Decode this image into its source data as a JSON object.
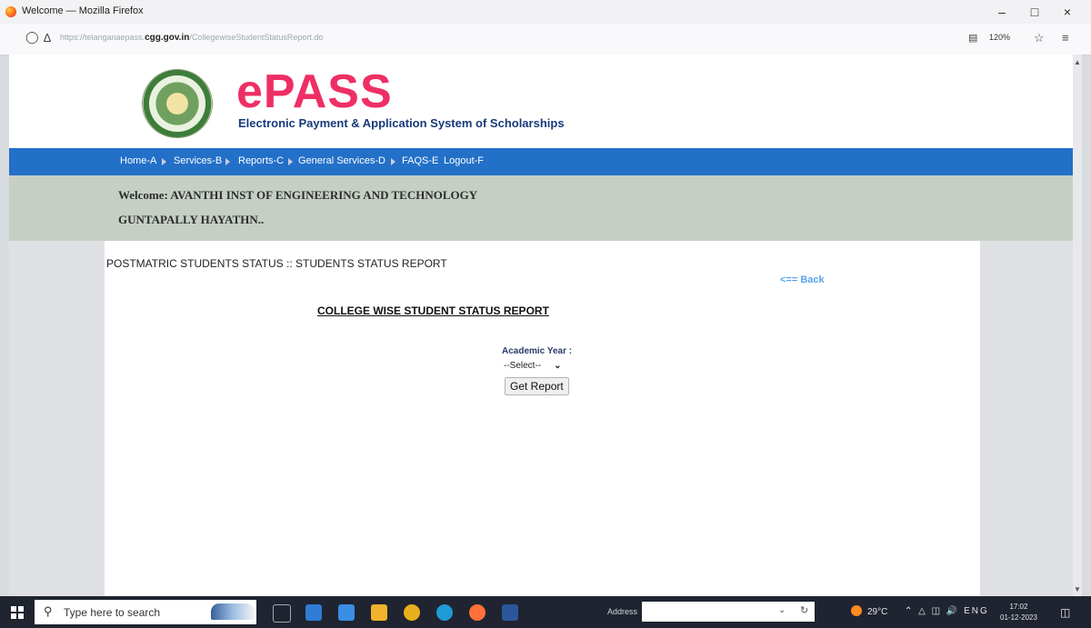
{
  "window": {
    "title": "Welcome — Mozilla Firefox",
    "controls": {
      "minimize": "–",
      "maximize": "□",
      "close": "×"
    }
  },
  "browser": {
    "url_prefix": "https://telanganaepass.",
    "url_domain": "cgg.gov.in",
    "url_path": "/CollegewiseStudentStatusReport.do",
    "zoom": "120%",
    "icons": [
      "circle-icon",
      "lock-icon",
      "reader-icon",
      "star-icon",
      "menu-icon"
    ]
  },
  "site": {
    "logo": "ePASS",
    "subtitle": "Electronic Payment & Application System of Scholarships",
    "nav": [
      "Home-A",
      "Services-B",
      "Reports-C",
      "General Services-D",
      "FAQS-E",
      "Logout-F"
    ],
    "welcome_line1": "Welcome: AVANTHI INST OF ENGINEERING AND TECHNOLOGY",
    "welcome_line2": "GUNTAPALLY HAYATHN.."
  },
  "report": {
    "breadcrumb": "POSTMATRIC STUDENTS STATUS :: STUDENTS STATUS REPORT",
    "back_link": "<== Back",
    "title": "COLLEGE WISE STUDENT STATUS REPORT",
    "academic_year_label": "Academic Year :",
    "academic_year_selected": "--Select--",
    "get_report_label": "Get Report"
  },
  "taskbar": {
    "search_placeholder": "Type here to search",
    "address_label": "Address",
    "temperature": "29°C",
    "tray_lang": "ENG",
    "time": "17:02",
    "date": "01-12-2023",
    "colors": {
      "store": "#2f7bd6",
      "mail": "#3a8ee6",
      "folder": "#f1b32b",
      "chrome": "#e8b01c",
      "edge": "#1e9ad6",
      "firefox": "#ff7139",
      "word": "#2b579a"
    }
  }
}
